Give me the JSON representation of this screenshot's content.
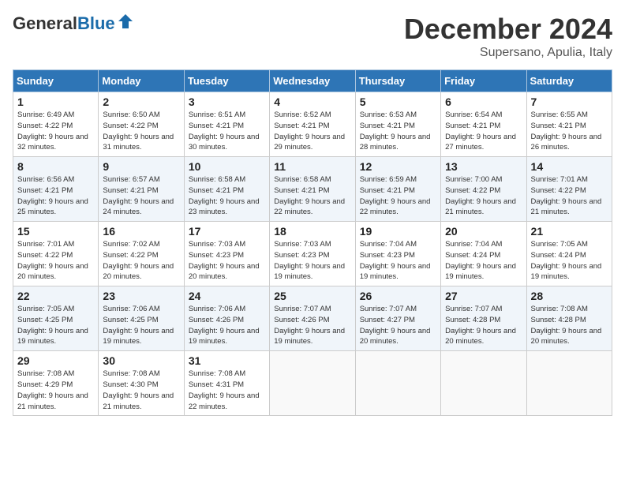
{
  "header": {
    "logo_general": "General",
    "logo_blue": "Blue",
    "month_title": "December 2024",
    "location": "Supersano, Apulia, Italy"
  },
  "days_of_week": [
    "Sunday",
    "Monday",
    "Tuesday",
    "Wednesday",
    "Thursday",
    "Friday",
    "Saturday"
  ],
  "weeks": [
    [
      {
        "day": "1",
        "sunrise": "6:49 AM",
        "sunset": "4:22 PM",
        "daylight": "9 hours and 32 minutes."
      },
      {
        "day": "2",
        "sunrise": "6:50 AM",
        "sunset": "4:22 PM",
        "daylight": "9 hours and 31 minutes."
      },
      {
        "day": "3",
        "sunrise": "6:51 AM",
        "sunset": "4:21 PM",
        "daylight": "9 hours and 30 minutes."
      },
      {
        "day": "4",
        "sunrise": "6:52 AM",
        "sunset": "4:21 PM",
        "daylight": "9 hours and 29 minutes."
      },
      {
        "day": "5",
        "sunrise": "6:53 AM",
        "sunset": "4:21 PM",
        "daylight": "9 hours and 28 minutes."
      },
      {
        "day": "6",
        "sunrise": "6:54 AM",
        "sunset": "4:21 PM",
        "daylight": "9 hours and 27 minutes."
      },
      {
        "day": "7",
        "sunrise": "6:55 AM",
        "sunset": "4:21 PM",
        "daylight": "9 hours and 26 minutes."
      }
    ],
    [
      {
        "day": "8",
        "sunrise": "6:56 AM",
        "sunset": "4:21 PM",
        "daylight": "9 hours and 25 minutes."
      },
      {
        "day": "9",
        "sunrise": "6:57 AM",
        "sunset": "4:21 PM",
        "daylight": "9 hours and 24 minutes."
      },
      {
        "day": "10",
        "sunrise": "6:58 AM",
        "sunset": "4:21 PM",
        "daylight": "9 hours and 23 minutes."
      },
      {
        "day": "11",
        "sunrise": "6:58 AM",
        "sunset": "4:21 PM",
        "daylight": "9 hours and 22 minutes."
      },
      {
        "day": "12",
        "sunrise": "6:59 AM",
        "sunset": "4:21 PM",
        "daylight": "9 hours and 22 minutes."
      },
      {
        "day": "13",
        "sunrise": "7:00 AM",
        "sunset": "4:22 PM",
        "daylight": "9 hours and 21 minutes."
      },
      {
        "day": "14",
        "sunrise": "7:01 AM",
        "sunset": "4:22 PM",
        "daylight": "9 hours and 21 minutes."
      }
    ],
    [
      {
        "day": "15",
        "sunrise": "7:01 AM",
        "sunset": "4:22 PM",
        "daylight": "9 hours and 20 minutes."
      },
      {
        "day": "16",
        "sunrise": "7:02 AM",
        "sunset": "4:22 PM",
        "daylight": "9 hours and 20 minutes."
      },
      {
        "day": "17",
        "sunrise": "7:03 AM",
        "sunset": "4:23 PM",
        "daylight": "9 hours and 20 minutes."
      },
      {
        "day": "18",
        "sunrise": "7:03 AM",
        "sunset": "4:23 PM",
        "daylight": "9 hours and 19 minutes."
      },
      {
        "day": "19",
        "sunrise": "7:04 AM",
        "sunset": "4:23 PM",
        "daylight": "9 hours and 19 minutes."
      },
      {
        "day": "20",
        "sunrise": "7:04 AM",
        "sunset": "4:24 PM",
        "daylight": "9 hours and 19 minutes."
      },
      {
        "day": "21",
        "sunrise": "7:05 AM",
        "sunset": "4:24 PM",
        "daylight": "9 hours and 19 minutes."
      }
    ],
    [
      {
        "day": "22",
        "sunrise": "7:05 AM",
        "sunset": "4:25 PM",
        "daylight": "9 hours and 19 minutes."
      },
      {
        "day": "23",
        "sunrise": "7:06 AM",
        "sunset": "4:25 PM",
        "daylight": "9 hours and 19 minutes."
      },
      {
        "day": "24",
        "sunrise": "7:06 AM",
        "sunset": "4:26 PM",
        "daylight": "9 hours and 19 minutes."
      },
      {
        "day": "25",
        "sunrise": "7:07 AM",
        "sunset": "4:26 PM",
        "daylight": "9 hours and 19 minutes."
      },
      {
        "day": "26",
        "sunrise": "7:07 AM",
        "sunset": "4:27 PM",
        "daylight": "9 hours and 20 minutes."
      },
      {
        "day": "27",
        "sunrise": "7:07 AM",
        "sunset": "4:28 PM",
        "daylight": "9 hours and 20 minutes."
      },
      {
        "day": "28",
        "sunrise": "7:08 AM",
        "sunset": "4:28 PM",
        "daylight": "9 hours and 20 minutes."
      }
    ],
    [
      {
        "day": "29",
        "sunrise": "7:08 AM",
        "sunset": "4:29 PM",
        "daylight": "9 hours and 21 minutes."
      },
      {
        "day": "30",
        "sunrise": "7:08 AM",
        "sunset": "4:30 PM",
        "daylight": "9 hours and 21 minutes."
      },
      {
        "day": "31",
        "sunrise": "7:08 AM",
        "sunset": "4:31 PM",
        "daylight": "9 hours and 22 minutes."
      },
      null,
      null,
      null,
      null
    ]
  ]
}
